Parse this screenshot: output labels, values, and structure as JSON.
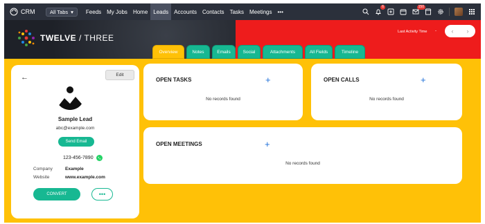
{
  "nav": {
    "app_name": "CRM",
    "all_tabs": "All Tabs",
    "links": [
      "Feeds",
      "My Jobs",
      "Home",
      "Leads",
      "Accounts",
      "Contacts",
      "Tasks",
      "Meetings"
    ],
    "active_link": "Leads",
    "more": "•••",
    "badges": {
      "notifications": "6",
      "mail": "150"
    }
  },
  "header": {
    "brand_bold": "TWELVE",
    "brand_light": " / THREE",
    "last_activity_label": "Last Activity Time",
    "last_activity_value": "-",
    "colors": {
      "left": "#1e2128",
      "right": "#ee1c1c"
    }
  },
  "tabs": [
    "Overview",
    "Notes",
    "Emails",
    "Social",
    "Attachments",
    "All Fields",
    "Timeline"
  ],
  "active_tab": "Overview",
  "profile": {
    "edit_label": "Edit",
    "name": "Sample Lead",
    "email": "abc@example.com",
    "send_email_label": "Send Email",
    "phone": "123-456-7890",
    "fields": [
      {
        "label": "Company",
        "value": "Example"
      },
      {
        "label": "Website",
        "value": "www.example.com"
      }
    ],
    "convert_label": "CONVERT",
    "more_label": "•••"
  },
  "panels": {
    "tasks": {
      "title": "OPEN TASKS",
      "empty": "No records found"
    },
    "calls": {
      "title": "OPEN CALLS",
      "empty": "No records found"
    },
    "meetings": {
      "title": "OPEN MEETINGS",
      "empty": "No records found"
    }
  },
  "colors": {
    "accent_green": "#17b892",
    "page_yellow": "#ffc107",
    "plus_blue": "#1e6fd9"
  }
}
